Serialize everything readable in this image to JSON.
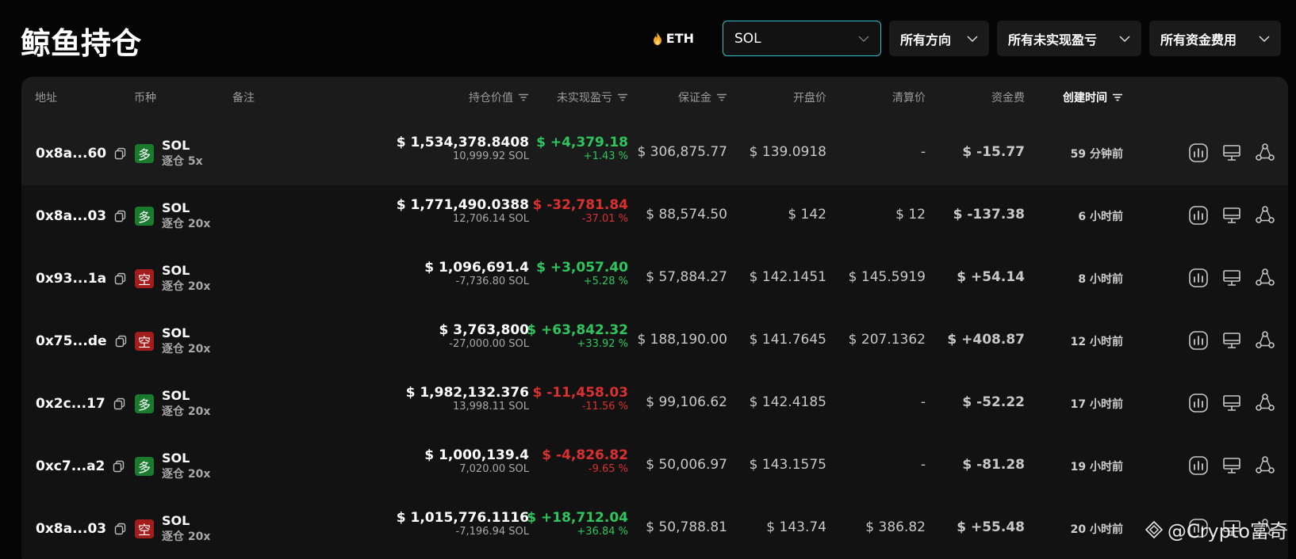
{
  "page": {
    "title": "鲸鱼持仓"
  },
  "filters": {
    "eth_label": "ETH",
    "coin_select": "SOL",
    "direction_select": "所有方向",
    "pnl_select": "所有未实现盈亏",
    "funding_select": "所有资金费用"
  },
  "table": {
    "headers": {
      "address": "地址",
      "coin": "币种",
      "note": "备注",
      "value": "持仓价值",
      "pnl": "未实现盈亏",
      "margin": "保证金",
      "open_price": "开盘价",
      "liq_price": "清算价",
      "funding": "资金费",
      "created": "创建时间"
    },
    "rows": [
      {
        "address": "0x8a...60",
        "side": "多",
        "side_type": "long",
        "coin": "SOL",
        "leverage": "逐仓 5x",
        "value": "$ 1,534,378.8408",
        "size": "10,999.92 SOL",
        "pnl": "$ +4,379.18",
        "pnl_pct": "+1.43 %",
        "pnl_sign": "pos",
        "margin": "$ 306,875.77",
        "open_price": "$ 139.0918",
        "liq_price": "-",
        "funding": "$ -15.77",
        "funding_sign": "neg",
        "created": "59 分钟前"
      },
      {
        "address": "0x8a...03",
        "side": "多",
        "side_type": "long",
        "coin": "SOL",
        "leverage": "逐仓 20x",
        "value": "$ 1,771,490.0388",
        "size": "12,706.14 SOL",
        "pnl": "$ -32,781.84",
        "pnl_pct": "-37.01 %",
        "pnl_sign": "neg",
        "margin": "$ 88,574.50",
        "open_price": "$ 142",
        "liq_price": "$ 12",
        "funding": "$ -137.38",
        "funding_sign": "neg",
        "created": "6 小时前"
      },
      {
        "address": "0x93...1a",
        "side": "空",
        "side_type": "short",
        "coin": "SOL",
        "leverage": "逐仓 20x",
        "value": "$ 1,096,691.4",
        "size": "-7,736.80 SOL",
        "pnl": "$ +3,057.40",
        "pnl_pct": "+5.28 %",
        "pnl_sign": "pos",
        "margin": "$ 57,884.27",
        "open_price": "$ 142.1451",
        "liq_price": "$ 145.5919",
        "funding": "$ +54.14",
        "funding_sign": "pos",
        "created": "8 小时前"
      },
      {
        "address": "0x75...de",
        "side": "空",
        "side_type": "short",
        "coin": "SOL",
        "leverage": "逐仓 20x",
        "value": "$ 3,763,800",
        "size": "-27,000.00 SOL",
        "pnl": "$ +63,842.32",
        "pnl_pct": "+33.92 %",
        "pnl_sign": "pos",
        "margin": "$ 188,190.00",
        "open_price": "$ 141.7645",
        "liq_price": "$ 207.1362",
        "funding": "$ +408.87",
        "funding_sign": "pos",
        "created": "12 小时前"
      },
      {
        "address": "0x2c...17",
        "side": "多",
        "side_type": "long",
        "coin": "SOL",
        "leverage": "逐仓 20x",
        "value": "$ 1,982,132.376",
        "size": "13,998.11 SOL",
        "pnl": "$ -11,458.03",
        "pnl_pct": "-11.56 %",
        "pnl_sign": "neg",
        "margin": "$ 99,106.62",
        "open_price": "$ 142.4185",
        "liq_price": "-",
        "funding": "$ -52.22",
        "funding_sign": "neg",
        "created": "17 小时前"
      },
      {
        "address": "0xc7...a2",
        "side": "多",
        "side_type": "long",
        "coin": "SOL",
        "leverage": "逐仓 20x",
        "value": "$ 1,000,139.4",
        "size": "7,020.00 SOL",
        "pnl": "$ -4,826.82",
        "pnl_pct": "-9.65 %",
        "pnl_sign": "neg",
        "margin": "$ 50,006.97",
        "open_price": "$ 143.1575",
        "liq_price": "-",
        "funding": "$ -81.28",
        "funding_sign": "neg",
        "created": "19 小时前"
      },
      {
        "address": "0x8a...03",
        "side": "空",
        "side_type": "short",
        "coin": "SOL",
        "leverage": "逐仓 20x",
        "value": "$ 1,015,776.1116",
        "size": "-7,196.94 SOL",
        "pnl": "$ +18,712.04",
        "pnl_pct": "+36.84 %",
        "pnl_sign": "pos",
        "margin": "$ 50,788.81",
        "open_price": "$ 143.74",
        "liq_price": "$ 386.82",
        "funding": "$ +55.48",
        "funding_sign": "pos",
        "created": "20 小时前"
      }
    ]
  },
  "watermark": "@Crypto富奇",
  "colors": {
    "positive": "#2ec55e",
    "negative": "#d93030",
    "long_badge": "#1a7a2e",
    "short_badge": "#a31d1d",
    "select_border": "#2fbfcf"
  }
}
